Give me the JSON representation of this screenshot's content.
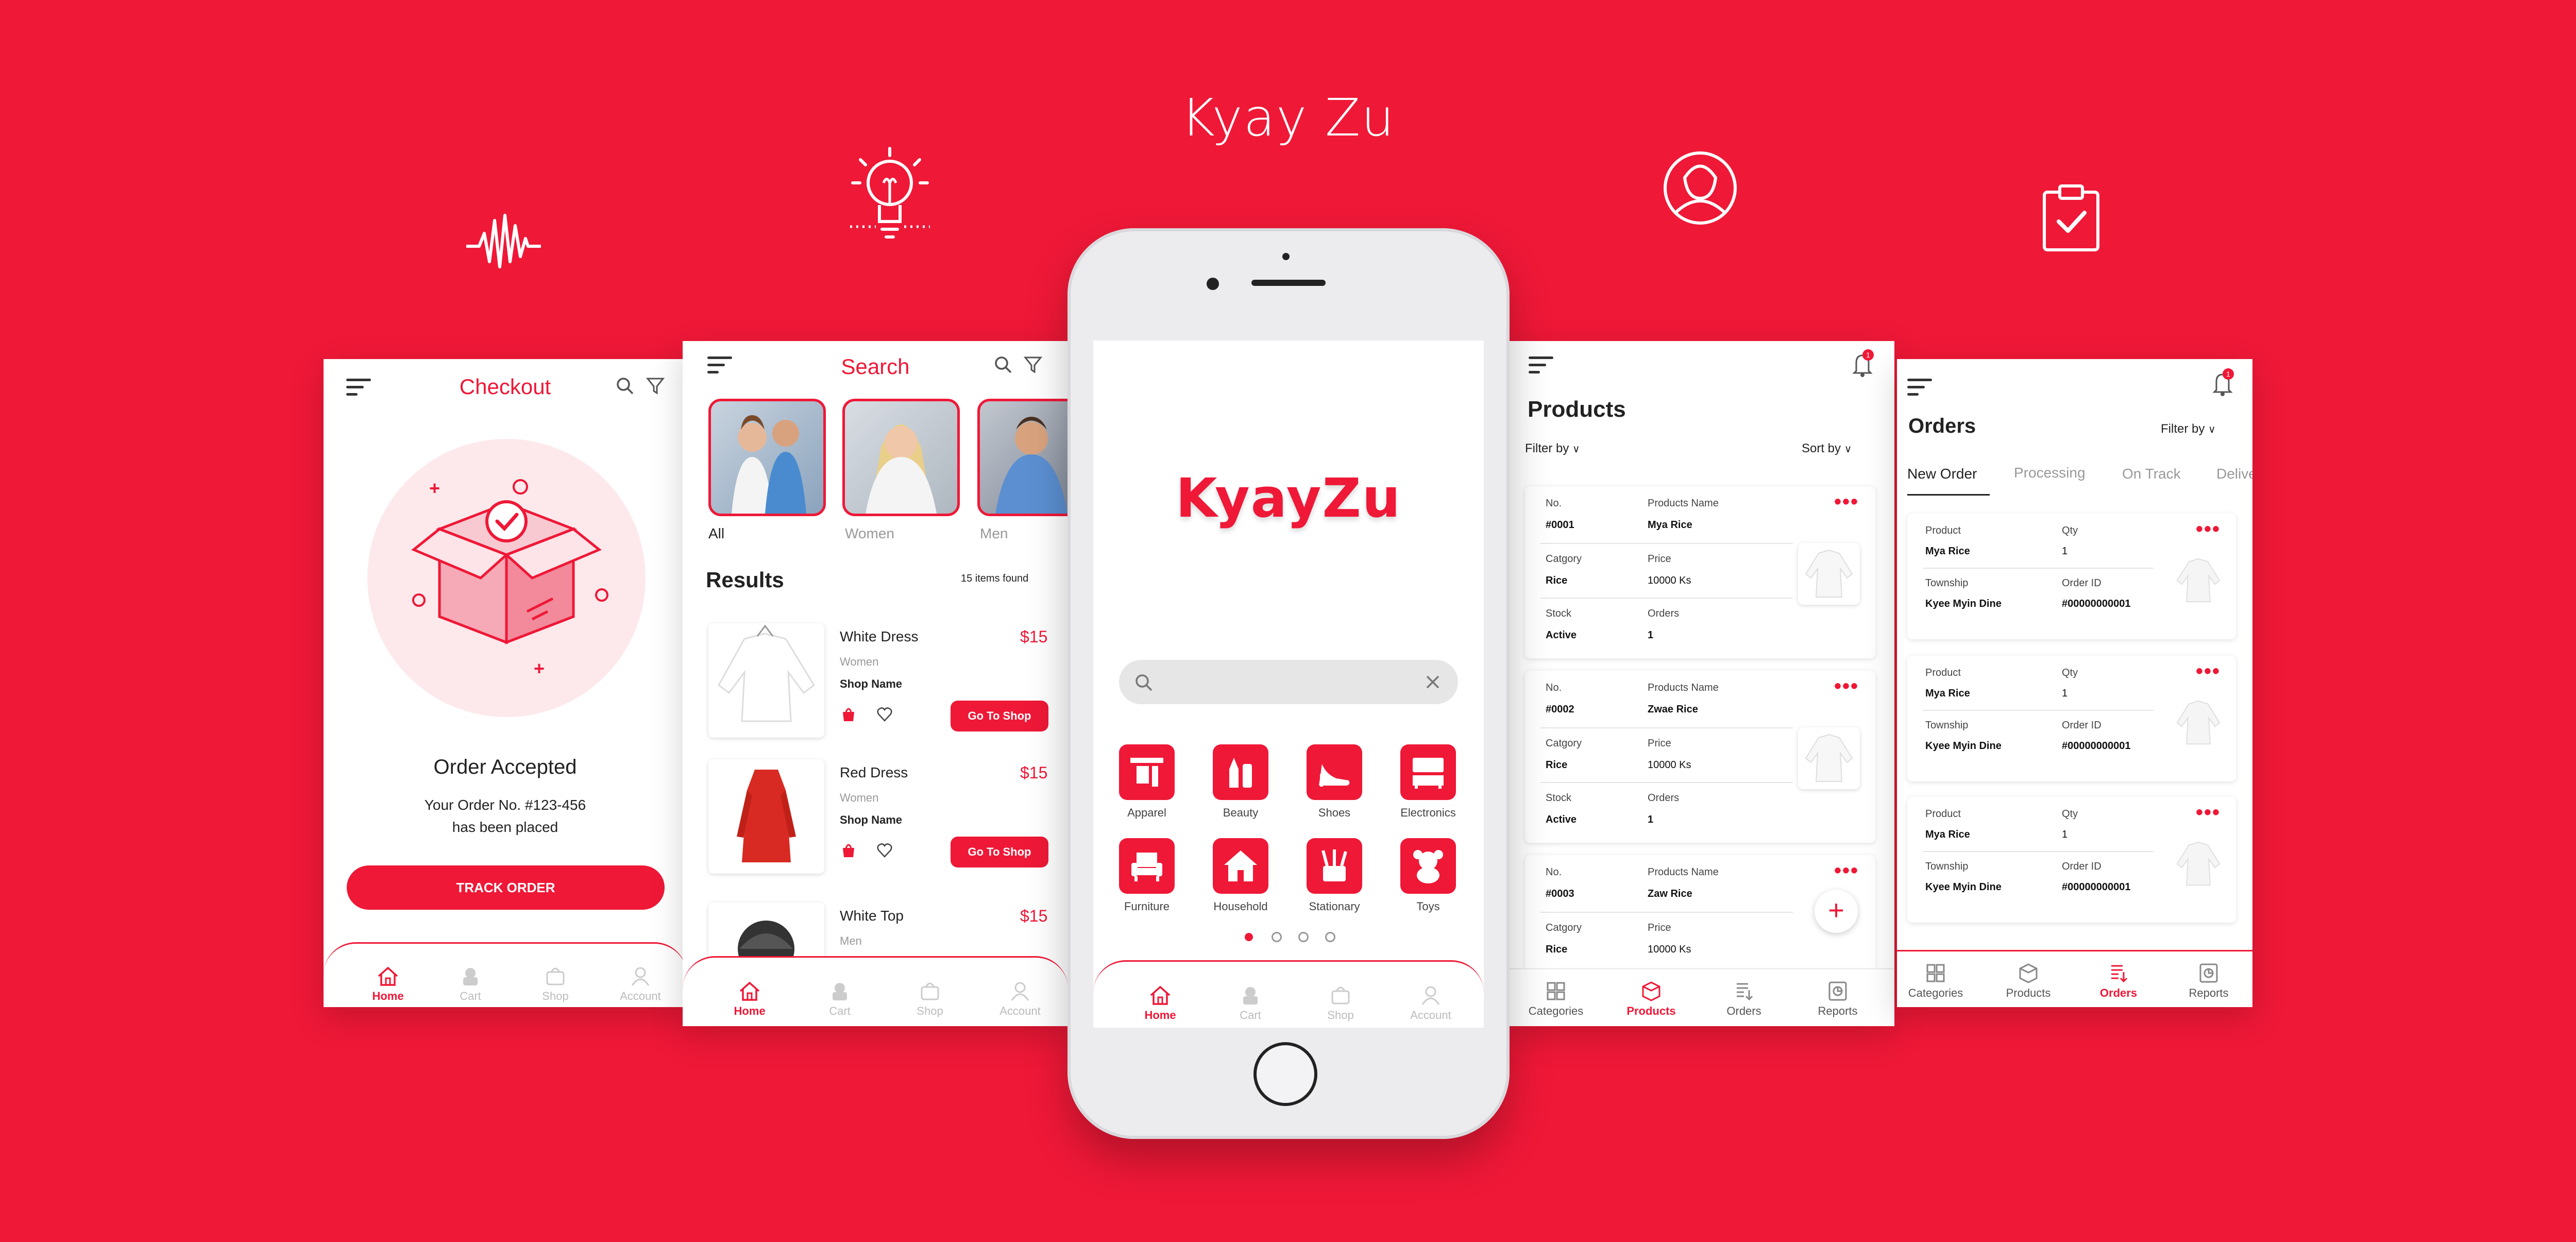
{
  "brand": {
    "title": "Kyay Zu"
  },
  "decorative_icons": [
    "sound-wave-icon",
    "lightbulb-icon",
    "user-circle-icon",
    "clipboard-check-icon"
  ],
  "checkout": {
    "title": "Checkout",
    "heading": "Order Accepted",
    "line1": "Your Order No. #123-456",
    "line2": "has been placed",
    "button": "TRACK ORDER",
    "nav": [
      "Home",
      "Cart",
      "Shop",
      "Account"
    ]
  },
  "search": {
    "title": "Search",
    "filters": [
      "All",
      "Women",
      "Men"
    ],
    "results_title": "Results",
    "results_count": "15 items found",
    "items": [
      {
        "name": "White Dress",
        "category": "Women",
        "shop": "Shop Name",
        "price": "$15",
        "button": "Go To Shop"
      },
      {
        "name": "Red Dress",
        "category": "Women",
        "shop": "Shop Name",
        "price": "$15",
        "button": "Go To Shop"
      },
      {
        "name": "White Top",
        "category": "Men",
        "price": "$15"
      }
    ],
    "nav": [
      "Home",
      "Cart",
      "Shop",
      "Account"
    ]
  },
  "home": {
    "logo": "KyayZu",
    "categories": [
      "Apparel",
      "Beauty",
      "Shoes",
      "Electronics",
      "Furniture",
      "Household",
      "Stationary",
      "Toys"
    ],
    "nav": [
      "Home",
      "Cart",
      "Shop",
      "Account"
    ]
  },
  "products": {
    "title": "Products",
    "notification_count": "1",
    "filter": "Filter by",
    "sort": "Sort by",
    "labels": {
      "no": "No.",
      "name": "Products Name",
      "category": "Catgory",
      "price": "Price",
      "stock": "Stock",
      "orders": "Orders"
    },
    "items": [
      {
        "no": "#0001",
        "name": "Mya Rice",
        "category": "Rice",
        "price": "10000 Ks",
        "stock": "Active",
        "orders": "1"
      },
      {
        "no": "#0002",
        "name": "Zwae Rice",
        "category": "Rice",
        "price": "10000 Ks",
        "stock": "Active",
        "orders": "1"
      },
      {
        "no": "#0003",
        "name": "Zaw  Rice",
        "category": "Rice",
        "price": "10000 Ks"
      }
    ],
    "nav": [
      "Categories",
      "Products",
      "Orders",
      "Reports"
    ]
  },
  "orders": {
    "title": "Orders",
    "notification_count": "1",
    "filter": "Filter by",
    "tabs": [
      "New Order",
      "Processing",
      "On Track",
      "Delive"
    ],
    "labels": {
      "product": "Product",
      "qty": "Qty",
      "township": "Township",
      "order_id": "Order ID"
    },
    "items": [
      {
        "product": "Mya Rice",
        "qty": "1",
        "township": "Kyee Myin Dine",
        "order_id": "#00000000001"
      },
      {
        "product": "Mya Rice",
        "qty": "1",
        "township": "Kyee Myin Dine",
        "order_id": "#00000000001"
      },
      {
        "product": "Mya Rice",
        "qty": "1",
        "township": "Kyee Myin Dine",
        "order_id": "#00000000001"
      }
    ],
    "nav": [
      "Categories",
      "Products",
      "Orders",
      "Reports"
    ]
  }
}
